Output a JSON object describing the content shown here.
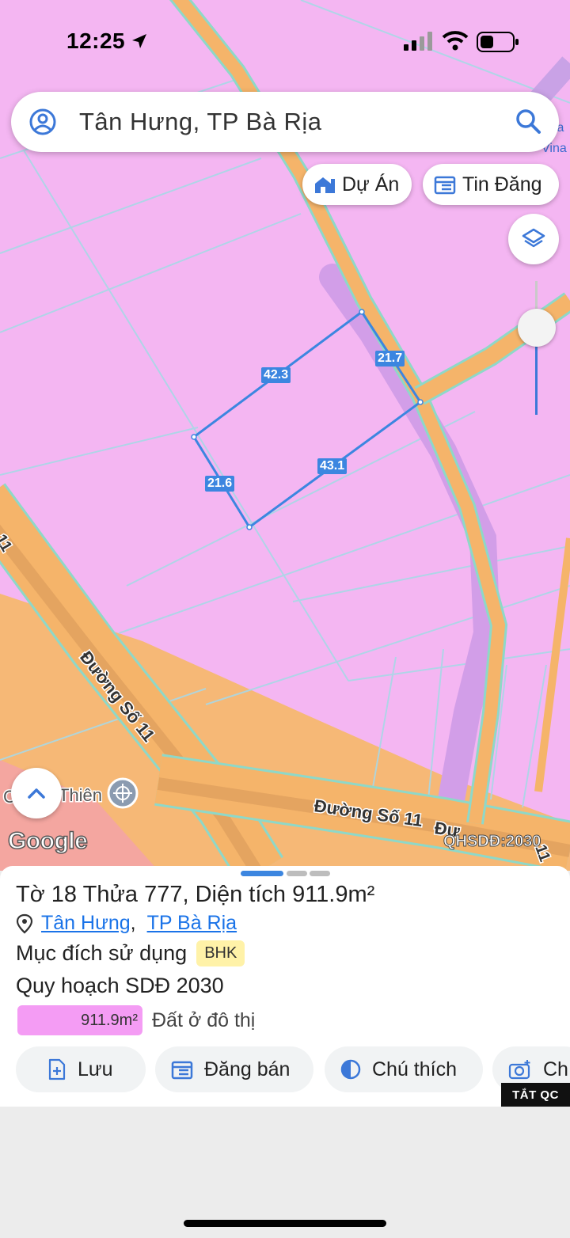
{
  "status": {
    "time": "12:25"
  },
  "search": {
    "query": "Tân Hưng, TP Bà Rịa"
  },
  "chips": {
    "du_an": "Dự Án",
    "tin_dang": "Tin Đăng"
  },
  "map": {
    "edges": [
      "42.3",
      "21.7",
      "21.6",
      "43.1"
    ],
    "street_labels": [
      "Đường Số 11",
      "Đường Số 11",
      "Đư"
    ],
    "street_label_edge": "11",
    "poi_label": "Thiên",
    "poi_prefix": "C",
    "right_edge_text": [
      "la",
      "Vina"
    ],
    "google": "Google",
    "layer_label": "QHSDĐ:2030"
  },
  "panel": {
    "title_prefix": "Tờ",
    "sheet": "18",
    "parcel_label": "Thửa",
    "parcel": "777",
    "area_label": ", Diện tích",
    "area": "911.9m²",
    "ward": "Tân Hưng",
    "separator": ",",
    "city": "TP Bà Rịa",
    "purpose_label": "Mục đích sử dụng",
    "purpose_code": "BHK",
    "plan_label": "Quy hoạch SDĐ 2030",
    "legend_area": "911.9m²",
    "legend_type": "Đất ở đô thị"
  },
  "actions": {
    "save": "Lưu",
    "sell": "Đăng bán",
    "legend": "Chú thích",
    "capture": "Ch"
  },
  "ad": {
    "hide": "TẮT QC"
  },
  "colors": {
    "land_residential": "#f4b6f2",
    "road": "#f5b46a",
    "accent": "#3c86e0"
  }
}
